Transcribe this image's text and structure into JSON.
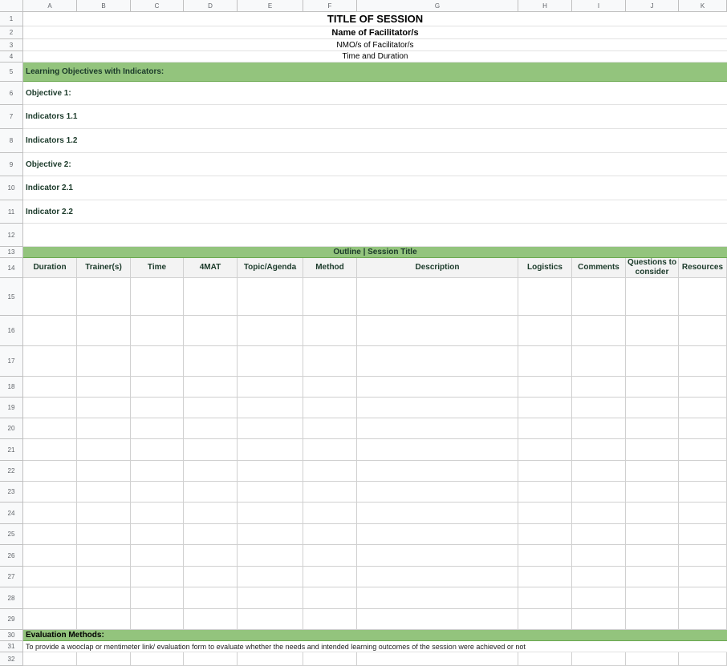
{
  "columns": [
    "A",
    "B",
    "C",
    "D",
    "E",
    "F",
    "G",
    "H",
    "I",
    "J",
    "K"
  ],
  "rows": [
    "1",
    "2",
    "3",
    "4",
    "5",
    "6",
    "7",
    "8",
    "9",
    "10",
    "11",
    "12",
    "13",
    "14",
    "15",
    "16",
    "17",
    "18",
    "19",
    "20",
    "21",
    "22",
    "23",
    "24",
    "25",
    "26",
    "27",
    "28",
    "29",
    "30",
    "31",
    "32"
  ],
  "header": {
    "title": "TITLE OF SESSION",
    "facilitator": "Name of Facilitator/s",
    "nmo": "NMO/s of Facilitator/s",
    "time": "Time and Duration"
  },
  "objectives": {
    "section_label": "Learning Objectives with Indicators:",
    "items": [
      "Objective 1:",
      "Indicators 1.1",
      "Indicators 1.2",
      "Objective 2:",
      "Indicator 2.1",
      "Indicator 2.2"
    ]
  },
  "outline": {
    "title": "Outline | Session Title",
    "headers": [
      "Duration",
      "Trainer(s)",
      "Time",
      "4MAT",
      "Topic/Agenda",
      "Method",
      "Description",
      "Logistics",
      "Comments",
      "Questions to consider",
      "Resources"
    ]
  },
  "evaluation": {
    "label": "Evaluation Methods:",
    "text": "To provide a wooclap or mentimeter link/ evaluation form to evaluate whether the needs and intended learning outcomes of the session were achieved or not"
  },
  "colors": {
    "band_green": "#93c47d",
    "header_gray": "#f8f9fa",
    "text_dark_green": "#1b3a2a"
  }
}
